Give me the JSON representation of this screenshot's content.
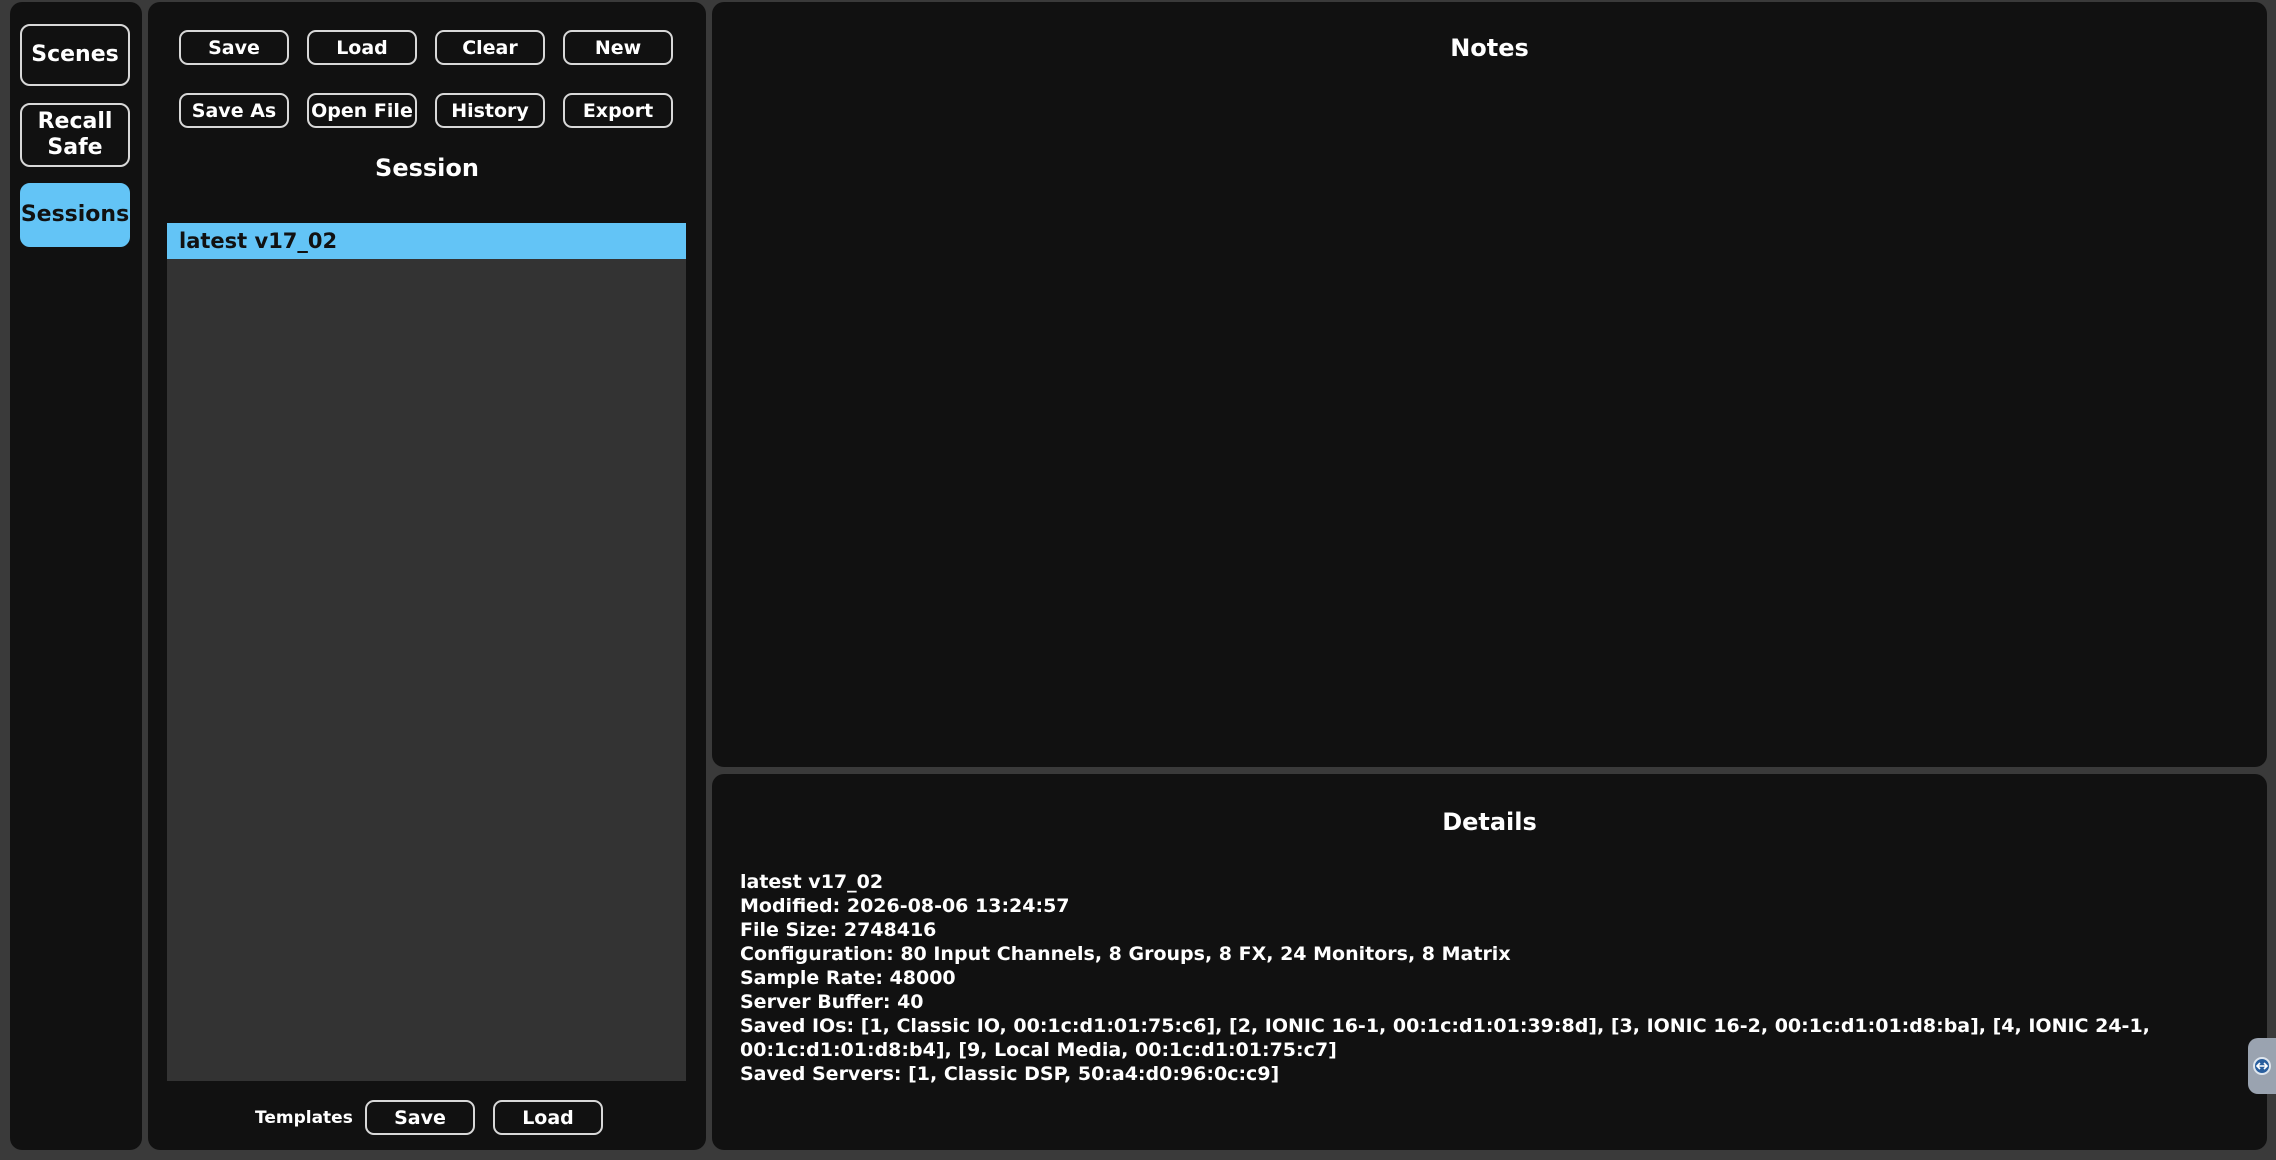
{
  "nav": {
    "items": [
      {
        "label": "Scenes",
        "active": false
      },
      {
        "label": "Recall Safe",
        "active": false
      },
      {
        "label": "Sessions",
        "active": true
      }
    ]
  },
  "toolbar": {
    "save": "Save",
    "load": "Load",
    "clear": "Clear",
    "new": "New",
    "save_as": "Save As",
    "open_file": "Open File",
    "history": "History",
    "export": "Export"
  },
  "session": {
    "title": "Session",
    "items": [
      "latest v17_02"
    ],
    "selected": "latest v17_02"
  },
  "templates": {
    "label": "Templates",
    "save": "Save",
    "load": "Load"
  },
  "notes": {
    "title": "Notes"
  },
  "details": {
    "title": "Details",
    "lines": [
      "latest v17_02",
      "Modified: 2026-08-06 13:24:57",
      "File Size: 2748416",
      "Configuration: 80 Input Channels, 8 Groups, 8 FX, 24 Monitors, 8 Matrix",
      "Sample Rate: 48000",
      "Server Buffer: 40",
      "Saved IOs: [1, Classic IO, 00:1c:d1:01:75:c6], [2, IONIC 16-1, 00:1c:d1:01:39:8d], [3, IONIC 16-2, 00:1c:d1:01:d8:ba], [4, IONIC 24-1, 00:1c:d1:01:d8:b4], [9, Local Media, 00:1c:d1:01:75:c7]",
      "Saved Servers: [1, Classic DSP, 50:a4:d0:96:0c:c9]"
    ]
  },
  "colors": {
    "accent": "#63c4f6",
    "panel": "#111111",
    "list_bg": "#333333"
  },
  "icons": {
    "side_handle": "remote-control-icon"
  }
}
